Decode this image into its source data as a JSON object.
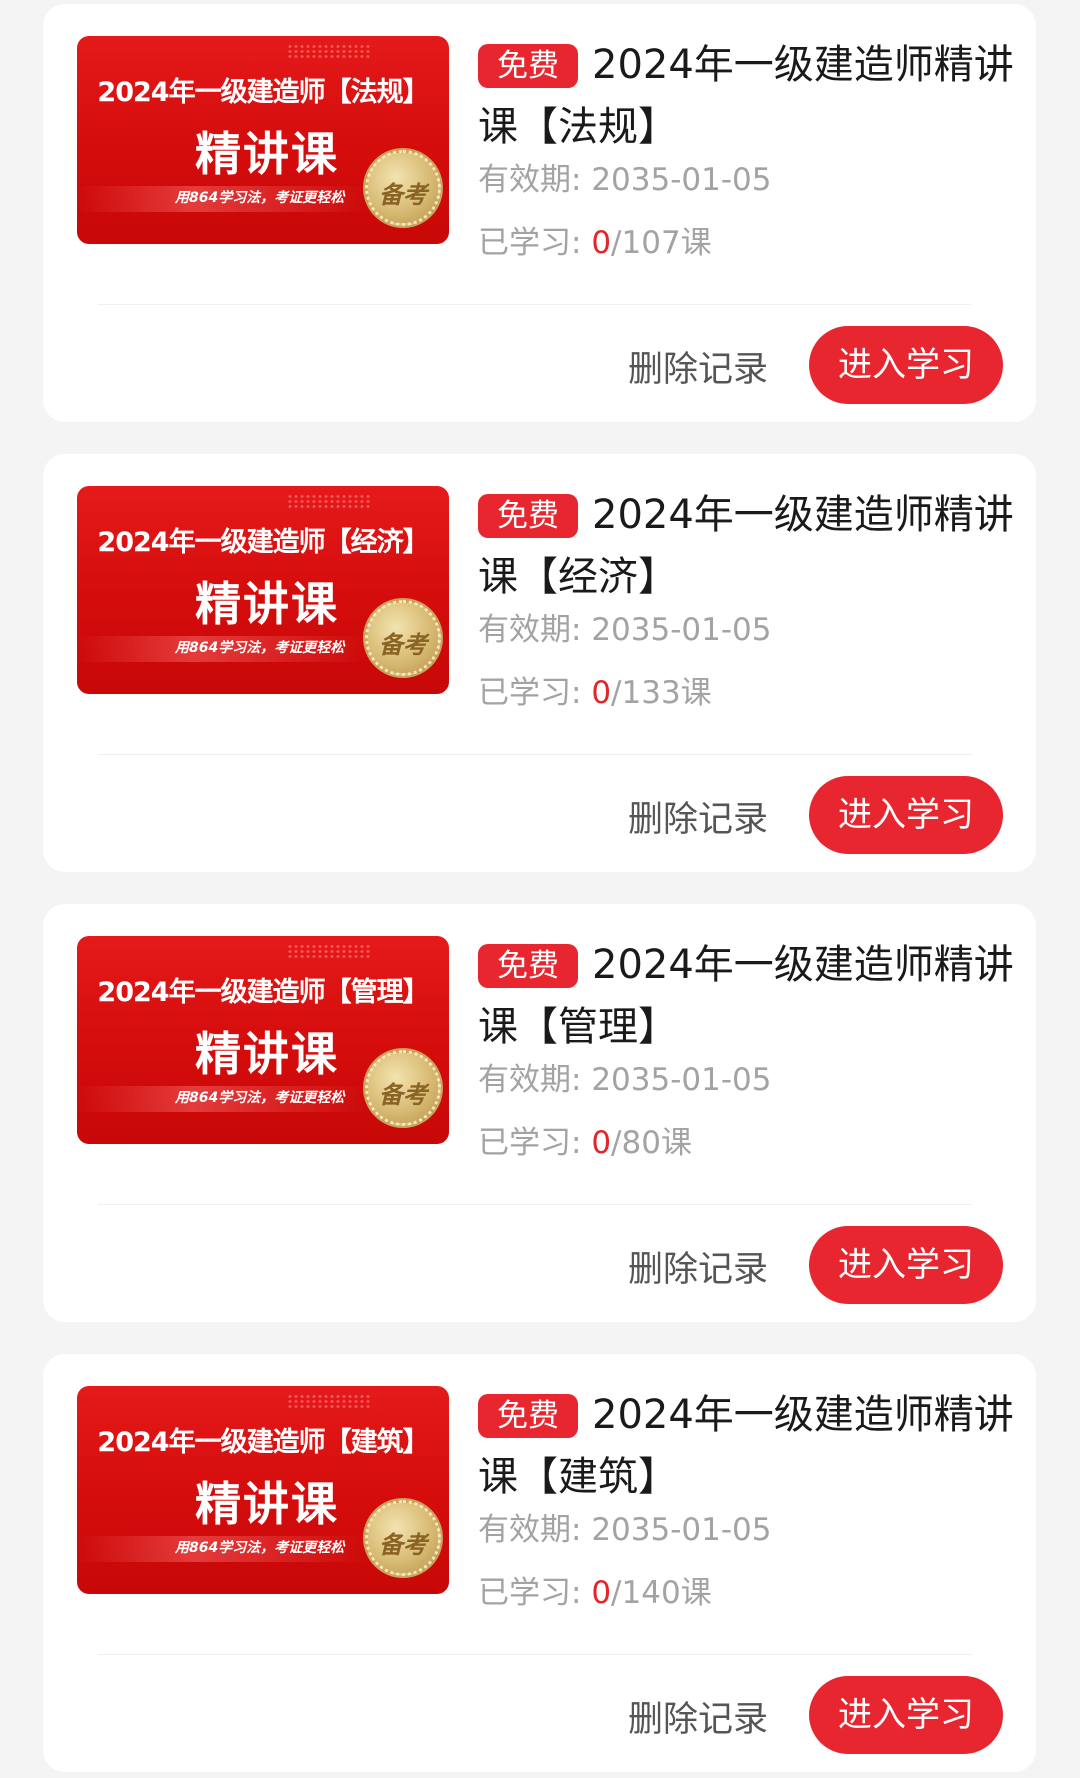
{
  "courses": [
    {
      "cover": {
        "headline": "2024年一级建造师【法规】",
        "main": "精讲课",
        "slogan": "用864学习法，考证更轻松",
        "seal": "备考"
      },
      "badge": "免费",
      "title": "2024年一级建造师精讲课【法规】",
      "validity_label": "有效期: ",
      "validity_date": "2035-01-05",
      "progress_label": "已学习: ",
      "progress_done": "0",
      "progress_total": "/107课",
      "delete_label": "删除记录",
      "enter_label": "进入学习"
    },
    {
      "cover": {
        "headline": "2024年一级建造师【经济】",
        "main": "精讲课",
        "slogan": "用864学习法，考证更轻松",
        "seal": "备考"
      },
      "badge": "免费",
      "title": "2024年一级建造师精讲课【经济】",
      "validity_label": "有效期: ",
      "validity_date": "2035-01-05",
      "progress_label": "已学习: ",
      "progress_done": "0",
      "progress_total": "/133课",
      "delete_label": "删除记录",
      "enter_label": "进入学习"
    },
    {
      "cover": {
        "headline": "2024年一级建造师【管理】",
        "main": "精讲课",
        "slogan": "用864学习法，考证更轻松",
        "seal": "备考"
      },
      "badge": "免费",
      "title": "2024年一级建造师精讲课【管理】",
      "validity_label": "有效期: ",
      "validity_date": "2035-01-05",
      "progress_label": "已学习: ",
      "progress_done": "0",
      "progress_total": "/80课",
      "delete_label": "删除记录",
      "enter_label": "进入学习"
    },
    {
      "cover": {
        "headline": "2024年一级建造师【建筑】",
        "main": "精讲课",
        "slogan": "用864学习法，考证更轻松",
        "seal": "备考"
      },
      "badge": "免费",
      "title": "2024年一级建造师精讲课【建筑】",
      "validity_label": "有效期: ",
      "validity_date": "2035-01-05",
      "progress_label": "已学习: ",
      "progress_done": "0",
      "progress_total": "/140课",
      "delete_label": "删除记录",
      "enter_label": "进入学习"
    }
  ],
  "colors": {
    "accent": "#e8262f",
    "progress_done": "#e2262c",
    "background": "#f4f4f4",
    "card": "#ffffff"
  }
}
